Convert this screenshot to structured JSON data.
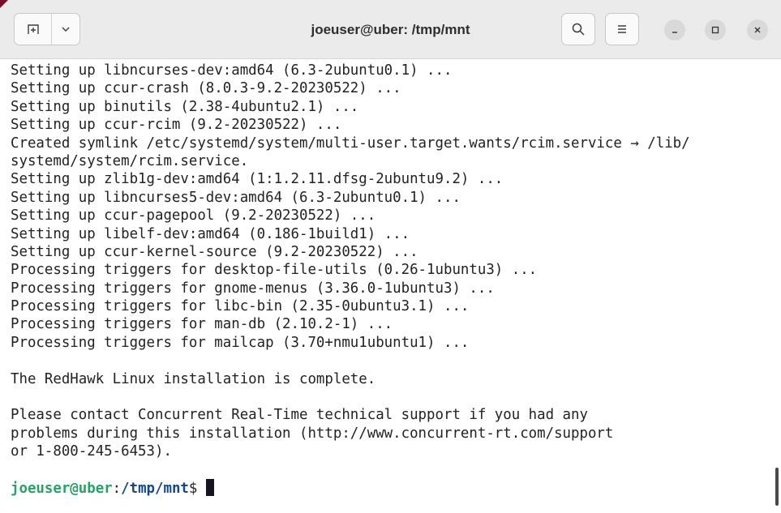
{
  "window": {
    "title": "joeuser@uber: /tmp/mnt"
  },
  "icons": {
    "new_tab": "new-tab-icon",
    "tab_menu": "chevron-down-icon",
    "search": "search-icon",
    "menu": "hamburger-menu-icon",
    "minimize": "minimize-icon",
    "maximize": "maximize-icon",
    "close": "close-icon"
  },
  "terminal": {
    "lines": [
      "Setting up libncurses-dev:amd64 (6.3-2ubuntu0.1) ...",
      "Setting up ccur-crash (8.0.3-9.2-20230522) ...",
      "Setting up binutils (2.38-4ubuntu2.1) ...",
      "Setting up ccur-rcim (9.2-20230522) ...",
      "Created symlink /etc/systemd/system/multi-user.target.wants/rcim.service → /lib/",
      "systemd/system/rcim.service.",
      "Setting up zlib1g-dev:amd64 (1:1.2.11.dfsg-2ubuntu9.2) ...",
      "Setting up libncurses5-dev:amd64 (6.3-2ubuntu0.1) ...",
      "Setting up ccur-pagepool (9.2-20230522) ...",
      "Setting up libelf-dev:amd64 (0.186-1build1) ...",
      "Setting up ccur-kernel-source (9.2-20230522) ...",
      "Processing triggers for desktop-file-utils (0.26-1ubuntu3) ...",
      "Processing triggers for gnome-menus (3.36.0-1ubuntu3) ...",
      "Processing triggers for libc-bin (2.35-0ubuntu3.1) ...",
      "Processing triggers for man-db (2.10.2-1) ...",
      "Processing triggers for mailcap (3.70+nmu1ubuntu1) ...",
      "",
      "The RedHawk Linux installation is complete.",
      "",
      "Please contact Concurrent Real-Time technical support if you had any",
      "problems during this installation (http://www.concurrent-rt.com/support",
      "or 1-800-245-6453).",
      ""
    ],
    "prompt": {
      "user_host": "joeuser@uber",
      "separator": ":",
      "path": "/tmp/mnt",
      "symbol": "$ "
    }
  },
  "colors": {
    "prompt_user": "#26a269",
    "prompt_path": "#12488b",
    "text": "#222222",
    "titlebar": "#ebebeb"
  }
}
